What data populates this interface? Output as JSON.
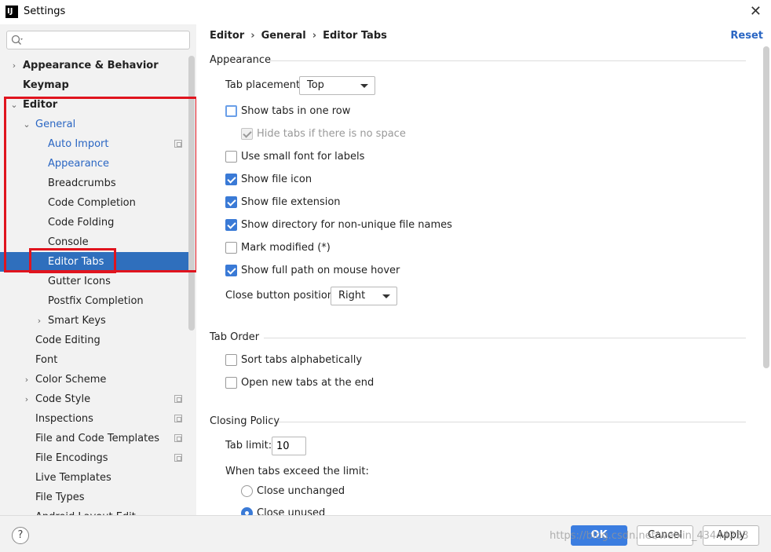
{
  "window": {
    "title": "Settings",
    "app_icon": "IJ"
  },
  "search": {
    "placeholder": ""
  },
  "sidebar": {
    "items": [
      {
        "label": "Appearance & Behavior"
      },
      {
        "label": "Keymap"
      },
      {
        "label": "Editor"
      },
      {
        "label": "General"
      },
      {
        "label": "Auto Import"
      },
      {
        "label": "Appearance"
      },
      {
        "label": "Breadcrumbs"
      },
      {
        "label": "Code Completion"
      },
      {
        "label": "Code Folding"
      },
      {
        "label": "Console"
      },
      {
        "label": "Editor Tabs"
      },
      {
        "label": "Gutter Icons"
      },
      {
        "label": "Postfix Completion"
      },
      {
        "label": "Smart Keys"
      },
      {
        "label": "Code Editing"
      },
      {
        "label": "Font"
      },
      {
        "label": "Color Scheme"
      },
      {
        "label": "Code Style"
      },
      {
        "label": "Inspections"
      },
      {
        "label": "File and Code Templates"
      },
      {
        "label": "File Encodings"
      },
      {
        "label": "Live Templates"
      },
      {
        "label": "File Types"
      },
      {
        "label": "Android Layout Edit..."
      }
    ]
  },
  "breadcrumb": {
    "part1": "Editor",
    "part2": "General",
    "part3": "Editor Tabs",
    "sep": "›"
  },
  "reset_label": "Reset",
  "appearance": {
    "title": "Appearance",
    "tab_placement_label": "Tab placement:",
    "tab_placement_value": "Top",
    "show_tabs_one_row": "Show tabs in one row",
    "hide_tabs_no_space": "Hide tabs if there is no space",
    "small_font": "Use small font for labels",
    "show_file_icon": "Show file icon",
    "show_file_extension": "Show file extension",
    "show_directory": "Show directory for non-unique file names",
    "mark_modified": "Mark modified (*)",
    "show_full_path": "Show full path on mouse hover",
    "close_button_label": "Close button position:",
    "close_button_value": "Right"
  },
  "tab_order": {
    "title": "Tab Order",
    "sort_alpha": "Sort tabs alphabetically",
    "open_at_end": "Open new tabs at the end"
  },
  "closing_policy": {
    "title": "Closing Policy",
    "tab_limit_label": "Tab limit:",
    "tab_limit_value": "10",
    "exceed_label": "When tabs exceed the limit:",
    "close_unchanged": "Close unchanged",
    "close_unused": "Close unused"
  },
  "footer": {
    "help": "?",
    "ok": "OK",
    "cancel": "Cancel",
    "apply": "Apply",
    "watermark": "https://blog.csdn.net/weixin_43444253"
  },
  "colors": {
    "selection": "#2f6fbd",
    "link": "#2a66c3",
    "annotation": "#e0141e",
    "primary_button": "#3b7de0"
  }
}
